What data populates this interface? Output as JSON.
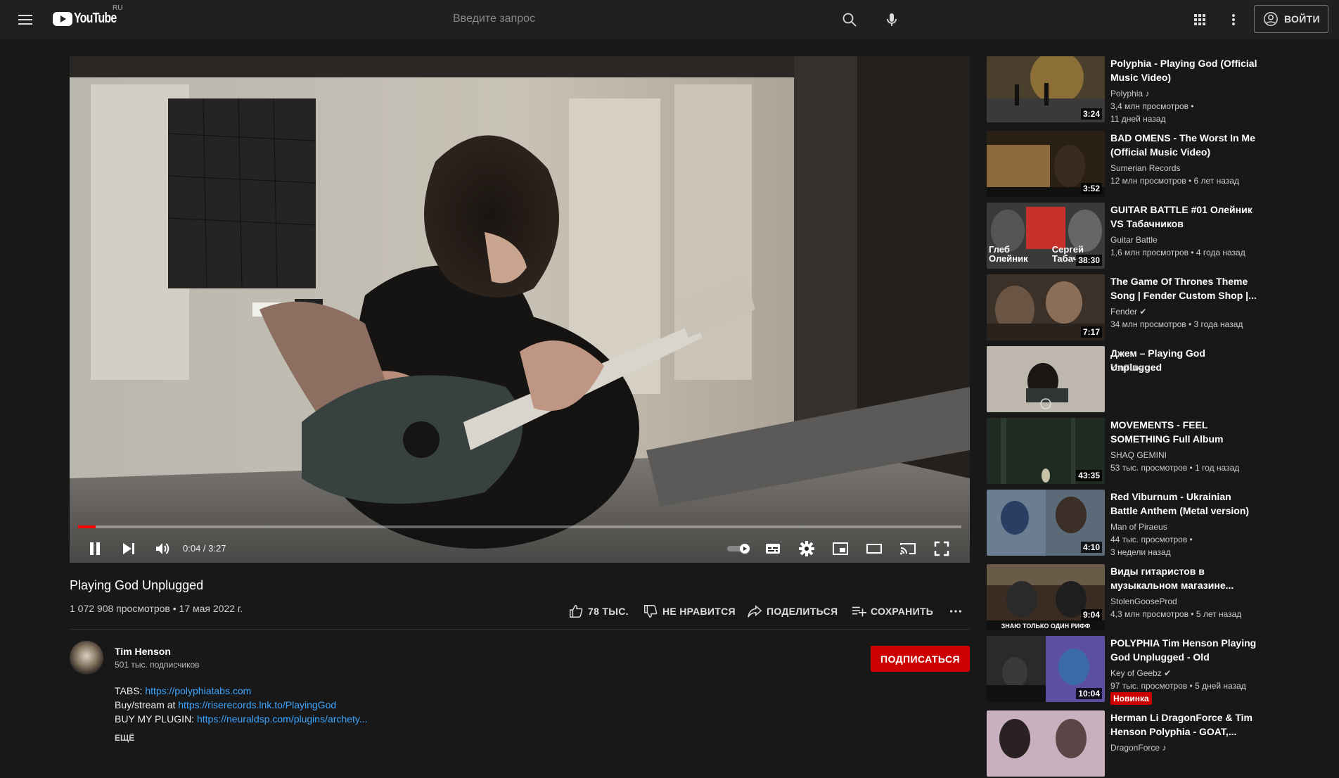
{
  "header": {
    "logo_text": "YouTube",
    "country_code": "RU",
    "search_placeholder": "Введите запрос",
    "signin_label": "ВОЙТИ"
  },
  "player": {
    "time": "0:04 / 3:27",
    "progress": 0.02
  },
  "video": {
    "title": "Playing God Unplugged",
    "views_date": "1 072 908 просмотров • 17 мая 2022 г.",
    "like_label": "78 ТЫС.",
    "dislike_label": "НЕ НРАВИТСЯ",
    "share_label": "ПОДЕЛИТЬСЯ",
    "save_label": "СОХРАНИТЬ"
  },
  "channel": {
    "name": "Tim Henson",
    "subscribers": "501 тыс. подписчиков",
    "subscribe_label": "ПОДПИСАТЬСЯ"
  },
  "description": [
    {
      "prefix": "TABS: ",
      "link": "https://polyphiatabs.com"
    },
    {
      "prefix": "Buy/stream at ",
      "link": "https://riserecords.lnk.to/PlayingGod"
    },
    {
      "prefix": "BUY MY PLUGIN: ",
      "link": "https://neuraldsp.com/plugins/archety..."
    }
  ],
  "more_label": "ЕЩЁ",
  "recommendations": [
    {
      "title": "Polyphia - Playing God (Official Music Video)",
      "channel": "Polyphia",
      "note": "♪",
      "meta1": "3,4 млн просмотров •",
      "meta2": "11 дней назад",
      "duration": "3:24"
    },
    {
      "title": "BAD OMENS - The Worst In Me (Official Music Video)",
      "channel": "Sumerian Records",
      "note": "",
      "meta1": "12 млн просмотров • 6 лет назад",
      "meta2": "",
      "duration": "3:52"
    },
    {
      "title": "GUITAR BATTLE #01 Олейник VS Табачников",
      "channel": "Guitar Battle",
      "note": "",
      "meta1": "1,6 млн просмотров • 4 года назад",
      "meta2": "",
      "duration": "38:30",
      "thumb_text_left": "Глеб Олейник",
      "thumb_text_right": "Сергей Табачн"
    },
    {
      "title": "The Game Of Thrones Theme Song | Fender Custom Shop |...",
      "channel": "Fender",
      "note": "✔",
      "meta1": "34 млн просмотров • 3 года назад",
      "meta2": "",
      "duration": "7:17"
    },
    {
      "title": "Джем – Playing God Unplugged",
      "channel": "YouTube",
      "note": "",
      "meta1": "",
      "meta2": "",
      "duration": ""
    },
    {
      "title": "MOVEMENTS - FEEL SOMETHING Full Album",
      "channel": "SHAQ GEMINI",
      "note": "",
      "meta1": "53 тыс. просмотров • 1 год назад",
      "meta2": "",
      "duration": "43:35"
    },
    {
      "title": "Red Viburnum - Ukrainian Battle Anthem (Metal version)",
      "channel": "Man of Piraeus",
      "note": "",
      "meta1": "44 тыс. просмотров •",
      "meta2": "3 недели назад",
      "duration": "4:10"
    },
    {
      "title": "Виды гитаристов в музыкальном магазине...",
      "channel": "StolenGooseProd",
      "note": "",
      "meta1": "4,3 млн просмотров • 5 лет назад",
      "meta2": "",
      "duration": "9:04",
      "thumb_caption": "ЗНАЮ ТОЛЬКО ОДИН РИФФ"
    },
    {
      "title": "POLYPHIA Tim Henson Playing God Unplugged - Old Compos...",
      "channel": "Key of Geebz",
      "note": "✔",
      "meta1": "97 тыс. просмотров • 5 дней назад",
      "meta2": "",
      "badge": "Новинка",
      "duration": "10:04"
    },
    {
      "title": "Herman Li DragonForce & Tim Henson Polyphia - GOAT,...",
      "channel": "DragonForce",
      "note": "♪",
      "meta1": "",
      "meta2": "",
      "duration": ""
    }
  ]
}
